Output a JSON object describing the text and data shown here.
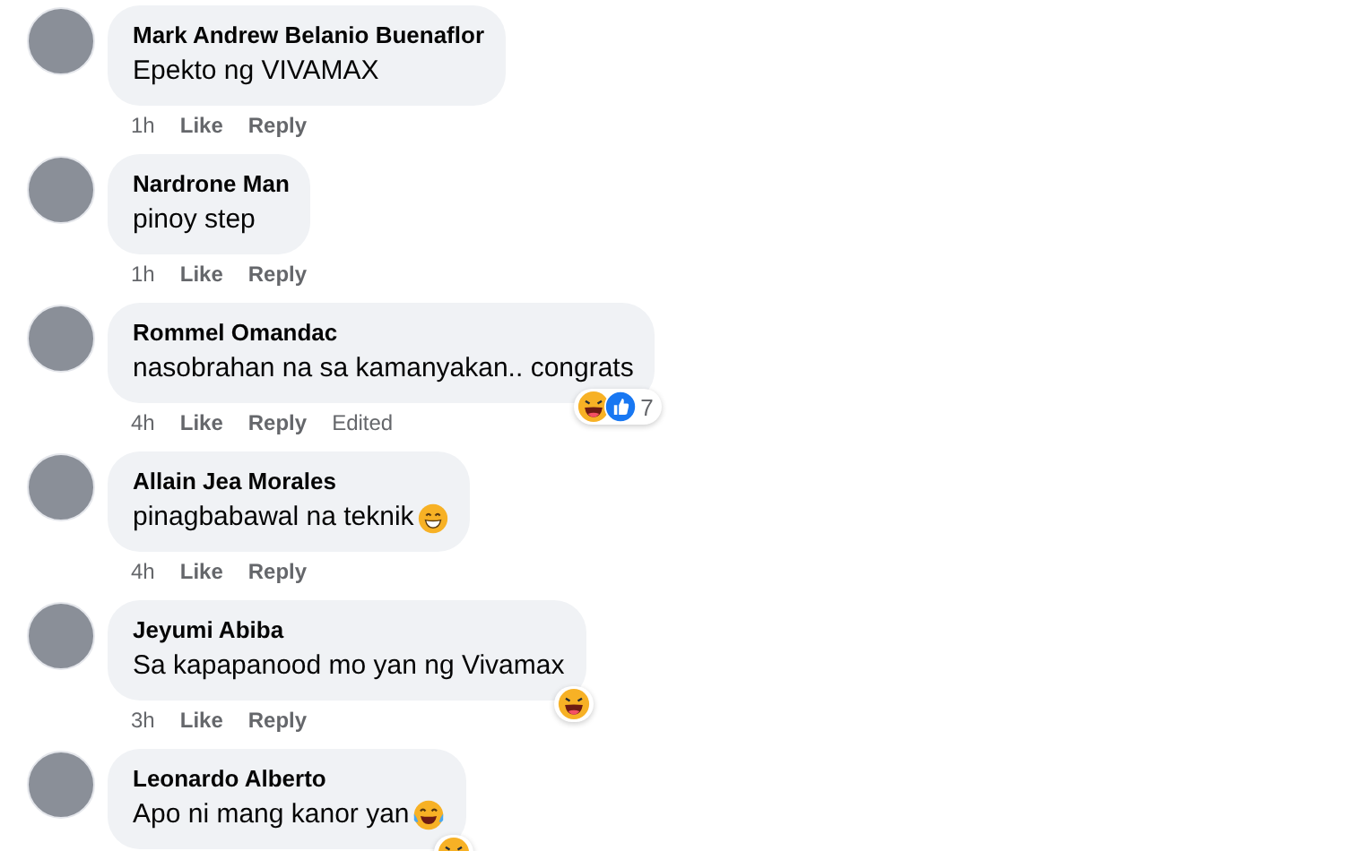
{
  "comments": [
    {
      "author": "Mark Andrew Belanio Buenaflor",
      "text": "Epekto ng VIVAMAX",
      "time": "1h",
      "actions": [
        "Like",
        "Reply"
      ]
    },
    {
      "author": "Nardrone Man",
      "text": "pinoy step",
      "time": "1h",
      "actions": [
        "Like",
        "Reply"
      ]
    },
    {
      "author": "Rommel Omandac",
      "text": "nasobrahan na sa kamanyakan.. congrats",
      "time": "4h",
      "actions": [
        "Like",
        "Reply"
      ],
      "edited": "Edited",
      "reactions": [
        {
          "kind": "haha"
        },
        {
          "kind": "like"
        }
      ],
      "reaction_count": "7"
    },
    {
      "author": "Allain Jea Morales",
      "text": "pinagbabawal na teknik",
      "inline_emoji": {
        "kind": "grin"
      },
      "time": "4h",
      "actions": [
        "Like",
        "Reply"
      ]
    },
    {
      "author": "Jeyumi Abiba",
      "text": "Sa kapapanood mo yan ng Vivamax",
      "time": "3h",
      "actions": [
        "Like",
        "Reply"
      ],
      "reactions": [
        {
          "kind": "haha"
        }
      ]
    },
    {
      "author": "Leonardo Alberto",
      "text": "Apo ni mang kanor yan",
      "inline_emoji": {
        "kind": "tears"
      },
      "reactions": [
        {
          "kind": "haha"
        }
      ]
    }
  ]
}
